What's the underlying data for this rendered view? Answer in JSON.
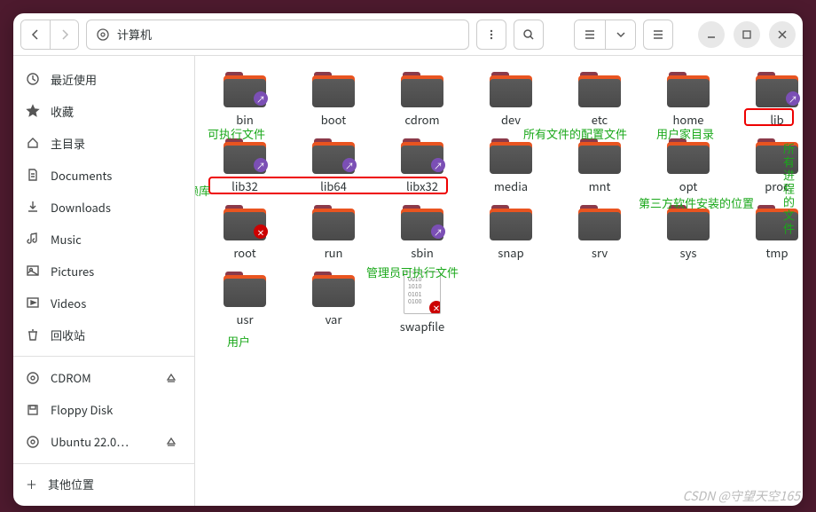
{
  "titlebar": {
    "path_label": "计算机"
  },
  "sidebar": {
    "items": [
      {
        "icon": "clock",
        "label": "最近使用"
      },
      {
        "icon": "star",
        "label": "收藏"
      },
      {
        "icon": "home",
        "label": "主目录"
      },
      {
        "icon": "doc",
        "label": "Documents"
      },
      {
        "icon": "download",
        "label": "Downloads"
      },
      {
        "icon": "music",
        "label": "Music"
      },
      {
        "icon": "picture",
        "label": "Pictures"
      },
      {
        "icon": "video",
        "label": "Videos"
      },
      {
        "icon": "trash",
        "label": "回收站"
      }
    ],
    "volumes": [
      {
        "icon": "disc",
        "label": "CDROM",
        "eject": true
      },
      {
        "icon": "floppy",
        "label": "Floppy Disk"
      },
      {
        "icon": "disc",
        "label": "Ubuntu 22.0…",
        "eject": true
      }
    ],
    "other": {
      "icon": "plus",
      "label": "其他位置"
    }
  },
  "folders": [
    {
      "name": "bin",
      "badge": "link"
    },
    {
      "name": "boot"
    },
    {
      "name": "cdrom"
    },
    {
      "name": "dev"
    },
    {
      "name": "etc"
    },
    {
      "name": "home"
    },
    {
      "name": "lib",
      "badge": "link"
    },
    {
      "name": "lib32",
      "badge": "link"
    },
    {
      "name": "lib64",
      "badge": "link"
    },
    {
      "name": "libx32",
      "badge": "link"
    },
    {
      "name": "media"
    },
    {
      "name": "mnt"
    },
    {
      "name": "opt"
    },
    {
      "name": "proc"
    },
    {
      "name": "root",
      "badge": "lock"
    },
    {
      "name": "run"
    },
    {
      "name": "sbin",
      "badge": "link"
    },
    {
      "name": "snap"
    },
    {
      "name": "srv"
    },
    {
      "name": "sys"
    },
    {
      "name": "tmp"
    },
    {
      "name": "usr"
    },
    {
      "name": "var"
    },
    {
      "name": "swapfile",
      "type": "file",
      "badge": "lock"
    }
  ],
  "annotations": {
    "bin": "可执行文件",
    "lib_deps": "可执行文件的依赖库",
    "etc": "所有文件的配置文件",
    "home": "用户家目录",
    "proc": "所有进程的文件",
    "opt": "第三方软件安装的位置",
    "sbin": "管理员可执行文件",
    "usr": "用户"
  },
  "watermark": "CSDN @守望天空165"
}
